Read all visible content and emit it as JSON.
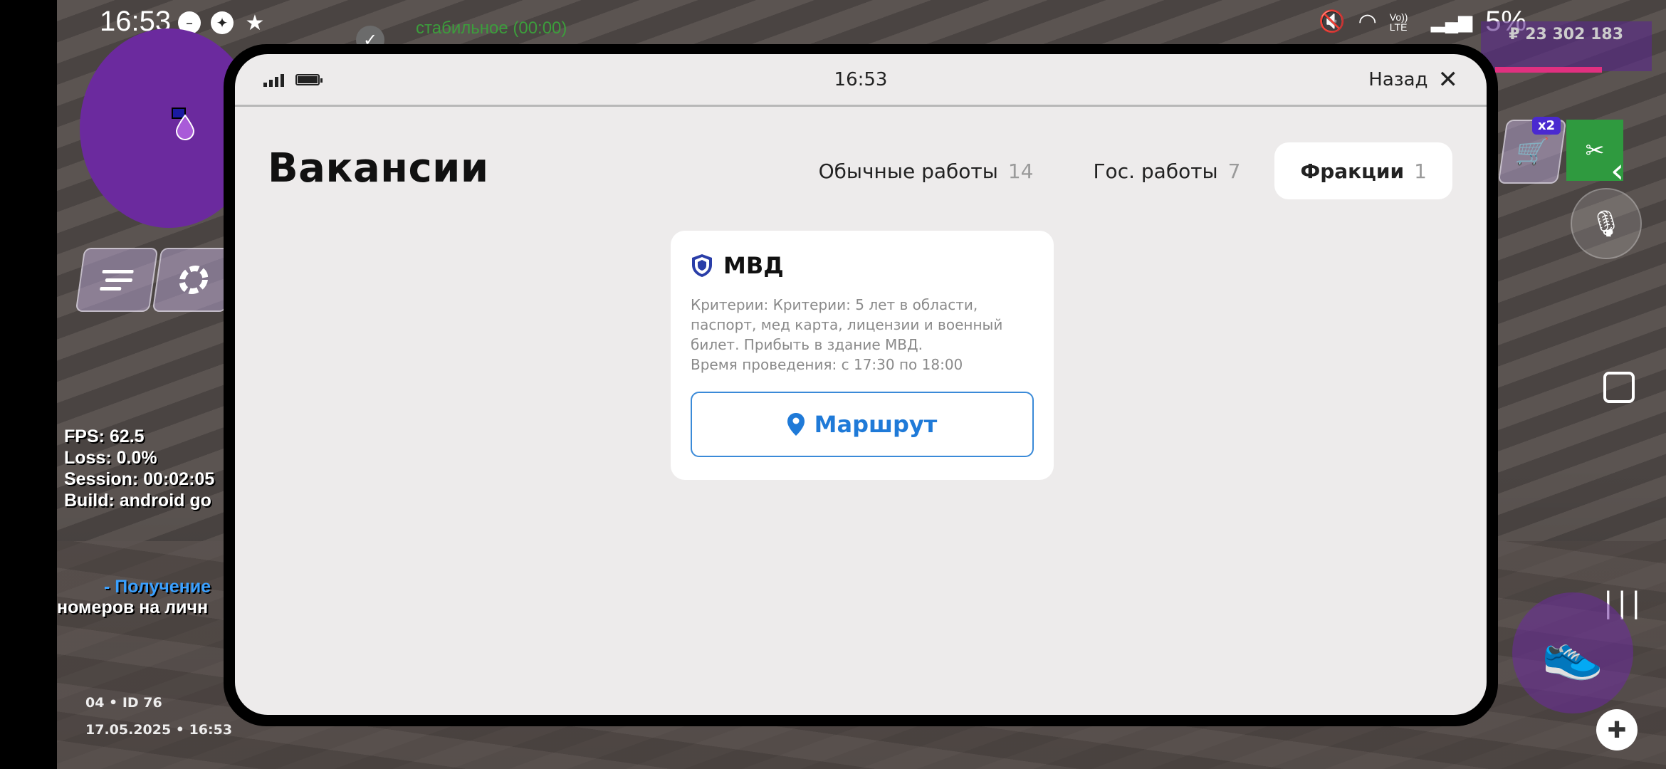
{
  "system": {
    "time": "16:53",
    "battery": "5%",
    "network_badge": "Vo)) LTE"
  },
  "game": {
    "connection": "стабильное (00:00)",
    "money": "₽ 23 302 183",
    "shop_badge": "x2",
    "hud": {
      "fps": "FPS: 62.5",
      "loss": "Loss: 0.0%",
      "session": "Session: 00:02:05",
      "build": "Build: android go"
    },
    "notice_line1": "- Получение",
    "notice_line2": "номеров на личн",
    "server_id": "04 • ID 76",
    "datetime": "17.05.2025 • 16:53",
    "colors": {
      "accent_purple": "#6b2a9e",
      "status_green": "#3c9d3c"
    }
  },
  "phone": {
    "time": "16:53",
    "back_label": "Назад",
    "title": "Вакансии",
    "tabs": [
      {
        "label": "Обычные работы",
        "count": "14",
        "active": false
      },
      {
        "label": "Гос. работы",
        "count": "7",
        "active": false
      },
      {
        "label": "Фракции",
        "count": "1",
        "active": true
      }
    ],
    "card": {
      "icon": "shield-icon",
      "title": "МВД",
      "description": "Критерии: Критерии: 5 лет в области, паспорт, мед карта, лицензии и военный билет. Прибыть в здание МВД.",
      "schedule": "Время проведения: с 17:30 по 18:00",
      "route_label": "Маршрут",
      "route_icon": "location-pin-icon",
      "accent": "#1f7ad8"
    }
  }
}
